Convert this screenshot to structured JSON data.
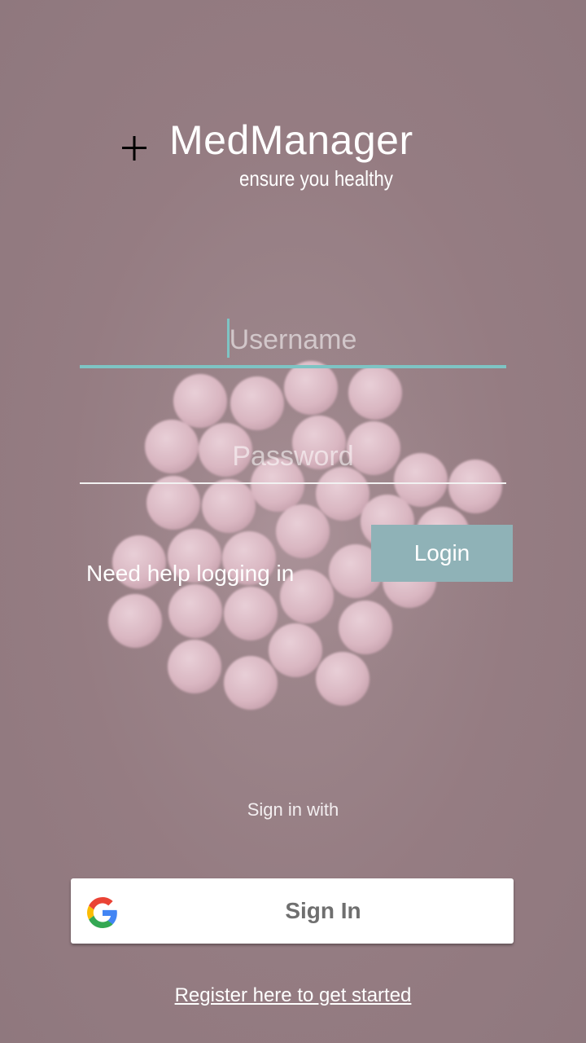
{
  "app": {
    "title": "MedManager",
    "tagline": "ensure you healthy",
    "logo_icon": "plus-icon"
  },
  "form": {
    "username_placeholder": "Username",
    "password_placeholder": "Password",
    "login_label": "Login",
    "help_label": "Need help logging in"
  },
  "social": {
    "signin_with_label": "Sign in with",
    "google_button_label": "Sign In",
    "google_icon": "google-icon"
  },
  "footer": {
    "register_label": "Register here to get started"
  },
  "colors": {
    "background": "#957c82",
    "accent": "#7ec4c4",
    "login_button": "#8fb2b7",
    "text": "#ffffff"
  }
}
